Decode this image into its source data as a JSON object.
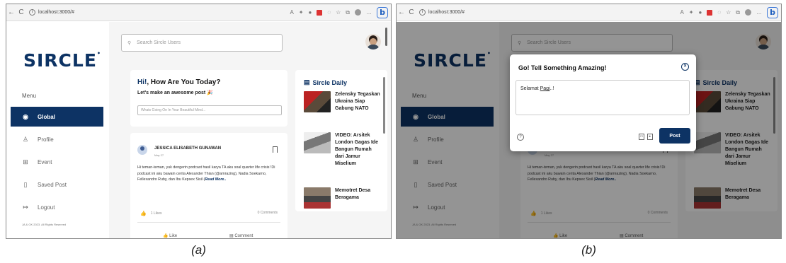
{
  "browser": {
    "url": "localhost:3000/#",
    "bing_label": "b"
  },
  "app": {
    "logo": "SIRCLE",
    "logo_mark": "•",
    "search_placeholder": "Search Sircle Users",
    "menu_heading": "Menu",
    "nav": [
      {
        "label": "Global",
        "icon": "globe-icon"
      },
      {
        "label": "Profile",
        "icon": "user-icon"
      },
      {
        "label": "Event",
        "icon": "calendar-icon"
      },
      {
        "label": "Saved Post",
        "icon": "bookmark-icon"
      },
      {
        "label": "Logout",
        "icon": "logout-icon"
      }
    ],
    "copyright": "JA & GK 2023. All Rights Reserved",
    "greeting_prefix": "Hi!",
    "greeting_rest": ", How Are You Today?",
    "greeting_sub": "Let's make an awesome post 🎉",
    "post_placeholder": "Whats Going On In Your Beautiful Mind...",
    "feed_post": {
      "author": "JESSICA ELISABETH GUNAWAN",
      "date": "May 27",
      "text": "Hi teman-teman, yuk dengerin podcast hasil karya TA aku soal quarter life crisis! Di podcast ini aku bawain cerita Alexander Thian (@amrazing), Nadia Soekarno, Fellexandro Ruby, dan Ibu Kepsex Sisil (",
      "read_more": "Read More..",
      "text_end": "",
      "likes": "1 Likes",
      "comments": "0 Comments",
      "like_action": "Like",
      "comment_action": "Comment"
    },
    "daily_title": "Sircle Daily",
    "news": [
      {
        "title": "Zelensky Tegaskan Ukraina Siap Gabung NATO"
      },
      {
        "title": "VIDEO: Arsitek London Gagas Ide Bangun Rumah dari Jamur Miselium"
      },
      {
        "title": "Memotret Desa Beragama"
      }
    ]
  },
  "modal": {
    "title": "Go! Tell Something Amazing!",
    "text_prefix": "Selamat ",
    "text_underlined": "Pagi",
    "text_suffix": "..!",
    "post_button": "Post"
  },
  "labels": {
    "a": "(a)",
    "b": "(b)"
  }
}
